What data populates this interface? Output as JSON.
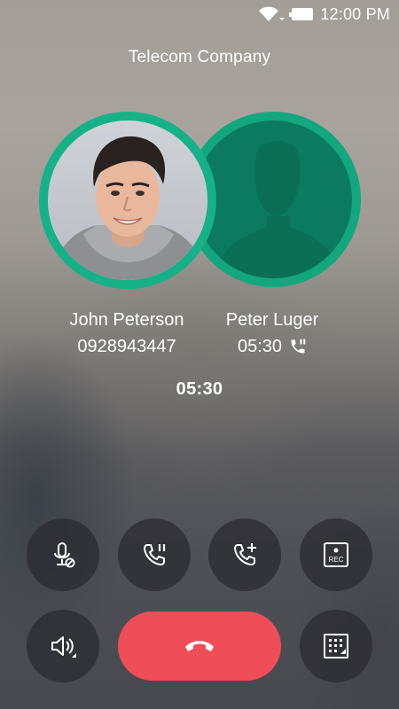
{
  "status_bar": {
    "time": "12:00 PM"
  },
  "carrier": "Telecom Company",
  "contacts": [
    {
      "name": "John Peterson",
      "number": "0928943447"
    },
    {
      "name": "Peter Luger",
      "duration": "05:30"
    }
  ],
  "call_timer": "05:30",
  "controls": {
    "record_label": "REC"
  },
  "icons": {
    "mute": "mic-mute-icon",
    "hold": "phone-hold-icon",
    "add_call": "phone-add-icon",
    "record": "record-icon",
    "speaker": "speaker-icon",
    "end_call": "phone-hangup-icon",
    "keypad": "dialpad-icon",
    "held": "phone-paused-icon"
  },
  "colors": {
    "accent": "#16b187",
    "avatar_placeholder": "#0c7a5e",
    "end_call": "#ef4e58",
    "button_bg": "#2c2c32"
  }
}
